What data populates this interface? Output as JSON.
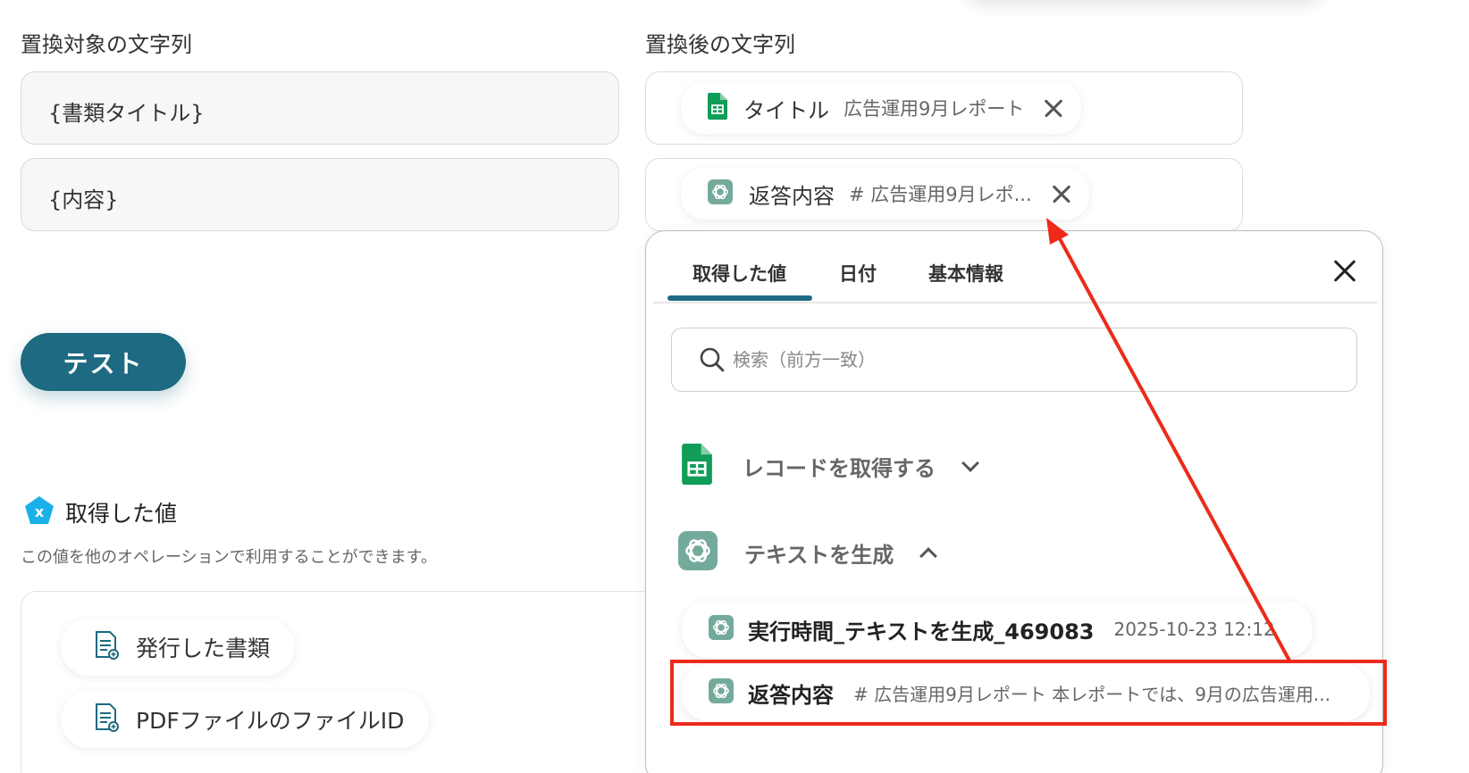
{
  "left": {
    "target_label": "置換対象の文字列",
    "fields": [
      "{書類タイトル}",
      "{内容}"
    ],
    "test_button": "テスト",
    "acquired_title": "取得した値",
    "acquired_desc": "この値を他のオペレーションで利用することができます。",
    "outputs": [
      "発行した書類",
      "PDFファイルのファイルID"
    ]
  },
  "right": {
    "replace_label": "置換後の文字列",
    "chips": [
      {
        "label": "タイトル",
        "value": "広告運用9月レポート"
      },
      {
        "label": "返答内容",
        "value": "# 広告運用9月レポ..."
      }
    ]
  },
  "panel": {
    "tabs": [
      "取得した値",
      "日付",
      "基本情報"
    ],
    "active_tab": "取得した値",
    "search_placeholder": "検索（前方一致）",
    "groups": [
      {
        "label": "レコードを取得する",
        "expanded": false
      },
      {
        "label": "テキストを生成",
        "expanded": true
      }
    ],
    "items": [
      {
        "label": "実行時間_テキストを生成_469083",
        "value": "2025-10-23 12:12"
      },
      {
        "label": "返答内容",
        "value": "# 広告運用9月レポート 本レポートでは、9月の広告運用..."
      }
    ]
  },
  "colors": {
    "accent": "#1d6a82",
    "annotation": "#ee2a1b",
    "sheets_green": "#0f9d58",
    "openai_teal": "#74aa9c",
    "yoom_blue": "#1ab0e8"
  },
  "icons": [
    "google-sheets-icon",
    "openai-icon",
    "yoom-icon",
    "document-icon",
    "search-icon",
    "close-icon",
    "chevron-down-icon",
    "chevron-up-icon"
  ]
}
